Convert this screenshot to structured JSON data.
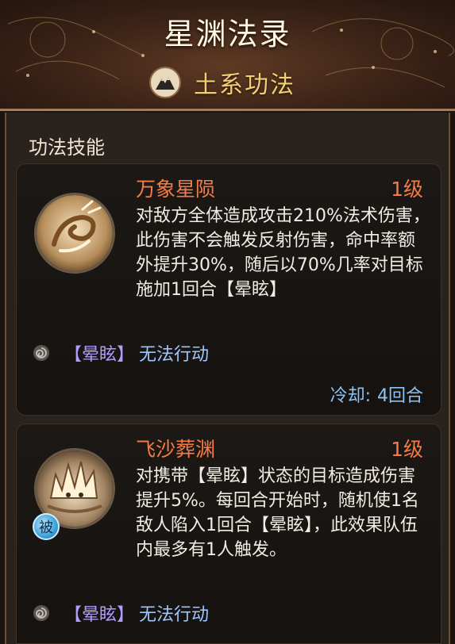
{
  "header": {
    "title": "星渊法录",
    "subtitle": "土系功法",
    "element_icon": "mountain-icon"
  },
  "section": {
    "title": "功法技能"
  },
  "skills": [
    {
      "name": "万象星陨",
      "level": "1级",
      "icon": "meteor-swirl-icon",
      "description": "对敌方全体造成攻击210%法术伤害，此伤害不会触发反射伤害，命中率额外提升30%，随后以70%几率对目标施加1回合【晕眩】",
      "effect_tag": "【晕眩】",
      "effect_text": "无法行动",
      "cooldown_label": "冷却:",
      "cooldown_value": "4回合"
    },
    {
      "name": "飞沙葬渊",
      "level": "1级",
      "icon": "sand-spike-icon",
      "passive_badge": "被",
      "description": "对携带【晕眩】状态的目标造成伤害提升5%。每回合开始时，随机使1名敌人陷入1回合【晕眩】，此效果队伍内最多有1人触发。",
      "effect_tag": "【晕眩】",
      "effect_text": "无法行动"
    }
  ],
  "colors": {
    "skill_name": "#f57b45",
    "subtitle": "#f6cf74",
    "effect_tag": "#b49cff",
    "effect_text": "#9ec7ff",
    "cooldown": "#8cc4f5"
  }
}
